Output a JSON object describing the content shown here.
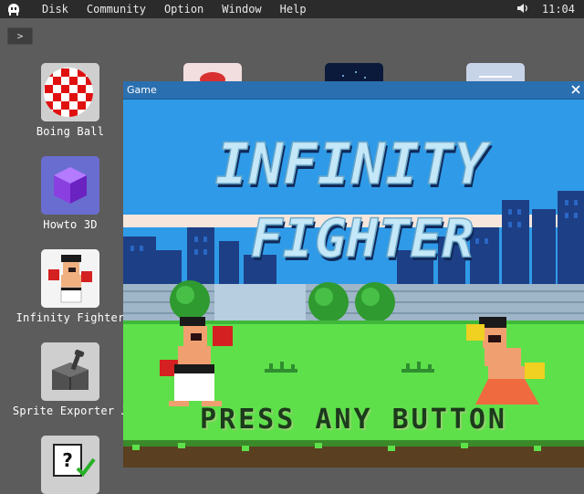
{
  "menubar": {
    "items": [
      "Disk",
      "Community",
      "Option",
      "Window",
      "Help"
    ],
    "clock": "11:04",
    "icons": [
      "app-logo-icon",
      "speaker-icon"
    ]
  },
  "desktop": {
    "expand_label": ">",
    "icons": [
      {
        "label": "Boing Ball",
        "icon": "boing-ball-icon"
      },
      {
        "label": "Howto 3D",
        "icon": "cube-icon"
      },
      {
        "label": "Infinity Fighter",
        "icon": "fighter-icon"
      },
      {
        "label": "Sprite Exporter J",
        "icon": "toolbox-icon"
      },
      {
        "label": "",
        "icon": "help-document-icon"
      }
    ]
  },
  "window": {
    "title": "Game",
    "close_icon": "close-icon"
  },
  "game": {
    "title_line1": "INFINITY",
    "title_line2": "FIGHTER",
    "prompt": "PRESS ANY BUTTON",
    "colors": {
      "sky": "#2f9be8",
      "grass": "#5ee04a",
      "title": "#9ad8f0"
    }
  }
}
